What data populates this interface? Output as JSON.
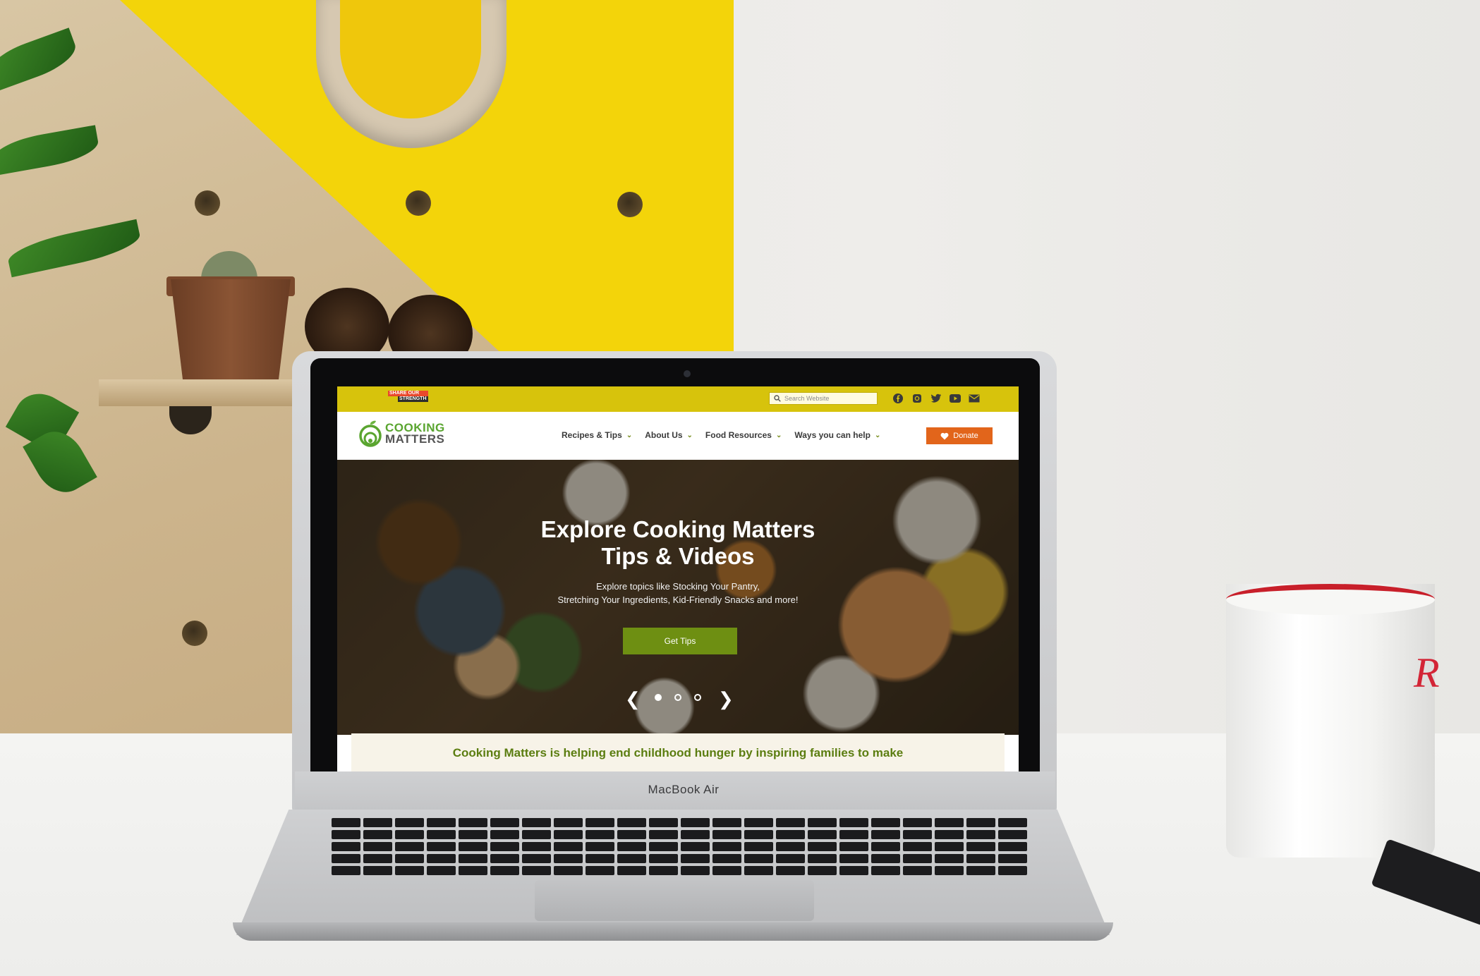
{
  "device": {
    "label": "MacBook Air"
  },
  "site": {
    "topbar": {
      "badge_line1": "SHARE OUR",
      "badge_line2": "STRENGTH",
      "search_placeholder": "Search Website",
      "social_icons": [
        "facebook-icon",
        "instagram-icon",
        "twitter-icon",
        "youtube-icon",
        "email-icon"
      ]
    },
    "logo": {
      "line1": "COOKING",
      "line2": "MATTERS"
    },
    "nav": {
      "items": [
        {
          "label": "Recipes & Tips"
        },
        {
          "label": "About Us"
        },
        {
          "label": "Food Resources"
        },
        {
          "label": "Ways you can help"
        }
      ],
      "donate_label": "Donate"
    },
    "hero": {
      "title_line1": "Explore Cooking Matters",
      "title_line2": "Tips & Videos",
      "sub_line1": "Explore topics like Stocking Your Pantry,",
      "sub_line2": "Stretching Your Ingredients, Kid-Friendly Snacks and more!",
      "button_label": "Get Tips",
      "slides_total": 3,
      "slide_active": 1
    },
    "tagline": "Cooking Matters is helping end childhood hunger by inspiring families to make"
  },
  "colors": {
    "topbar": "#d7c30c",
    "logo_green": "#5aa530",
    "donate": "#e2651b",
    "hero_button": "#6e8f12",
    "tagline": "#5b7d10"
  }
}
